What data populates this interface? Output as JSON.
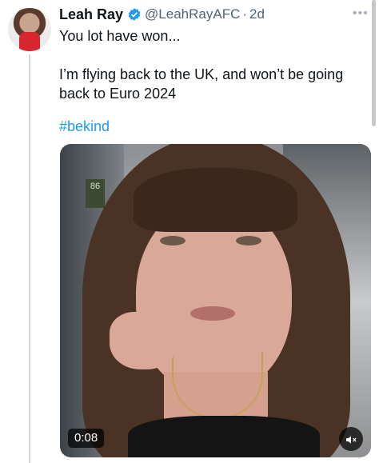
{
  "tweet": {
    "display_name": "Leah Ray",
    "handle": "@LeahRayAFC",
    "separator": "·",
    "time": "2d",
    "more_icon": "more-dots-icon",
    "verified_icon": "verified-badge-icon",
    "text_line_1": "You lot have won...",
    "text_line_2": "I’m flying back to the UK, and won’t be going back to Euro 2024",
    "hashtag": "#bekind"
  },
  "media": {
    "type": "video",
    "duration": "0:08",
    "mute_icon": "muted-speaker-icon",
    "background_sign": "86"
  },
  "colors": {
    "text": "#0f1419",
    "secondary_text": "#536471",
    "link": "#1d9bf0",
    "verified": "#1d9bf0",
    "thread_line": "#cfd9de"
  }
}
